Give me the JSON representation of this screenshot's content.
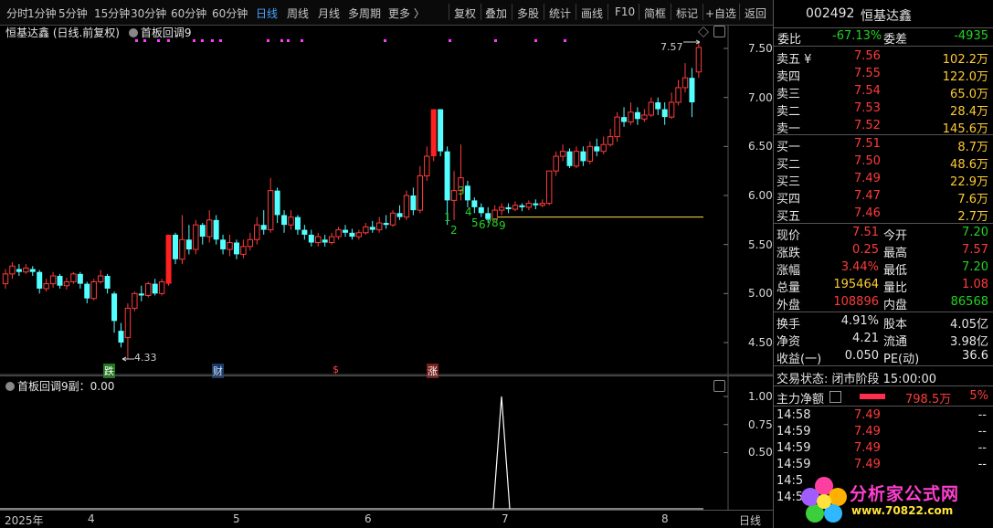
{
  "toolbar": {
    "items": [
      "分时",
      "1分钟",
      "5分钟",
      "15分钟",
      "30分钟",
      "60分钟",
      "日线",
      "周线",
      "月线",
      "多周期",
      "更多 〉"
    ],
    "right_items": [
      "复权",
      "叠加",
      "多股",
      "统计",
      "画线",
      "F10",
      "简框",
      "标记",
      "+自选",
      "返回"
    ]
  },
  "chart": {
    "title": "恒基达鑫 (日线.前复权)",
    "indicator": "首板回调9",
    "y_labels": [
      "7.50",
      "7.00",
      "6.50",
      "6.00",
      "5.50",
      "5.00",
      "4.50"
    ],
    "high_label": "7.57",
    "low_label": "4.33",
    "seq_labels": [
      "1",
      "2",
      "3",
      "4",
      "5",
      "6",
      "7",
      "8",
      "9"
    ],
    "flags": [
      "跌",
      "财",
      "$",
      "涨"
    ]
  },
  "sub_chart": {
    "title": "首板回调9副：0.00",
    "y_labels": [
      "1.00",
      "0.75",
      "0.50"
    ]
  },
  "xaxis": {
    "labels": [
      "2025年",
      "4",
      "5",
      "6",
      "7",
      "8"
    ],
    "period": "日线"
  },
  "quote": {
    "code": "002492",
    "name": "恒基达鑫",
    "weibi_label": "委比",
    "weibi": "-67.13%",
    "weicha_label": "委差",
    "weicha": "-4935",
    "asks": [
      {
        "label": "卖五 ¥",
        "price": "7.56",
        "vol": "102.2万"
      },
      {
        "label": "卖四",
        "price": "7.55",
        "vol": "122.0万"
      },
      {
        "label": "卖三",
        "price": "7.54",
        "vol": "65.0万"
      },
      {
        "label": "卖二",
        "price": "7.53",
        "vol": "28.4万"
      },
      {
        "label": "卖一",
        "price": "7.52",
        "vol": "145.6万"
      }
    ],
    "bids": [
      {
        "label": "买一",
        "price": "7.51",
        "vol": "8.7万"
      },
      {
        "label": "买二",
        "price": "7.50",
        "vol": "48.6万"
      },
      {
        "label": "买三",
        "price": "7.49",
        "vol": "22.9万"
      },
      {
        "label": "买四",
        "price": "7.47",
        "vol": "7.6万"
      },
      {
        "label": "买五",
        "price": "7.46",
        "vol": "2.7万"
      }
    ],
    "stats": [
      {
        "l1": "现价",
        "v1": "7.51",
        "c1": "red",
        "l2": "今开",
        "v2": "7.20",
        "c2": "green"
      },
      {
        "l1": "涨跌",
        "v1": "0.25",
        "c1": "red",
        "l2": "最高",
        "v2": "7.57",
        "c2": "red"
      },
      {
        "l1": "涨幅",
        "v1": "3.44%",
        "c1": "red",
        "l2": "最低",
        "v2": "7.20",
        "c2": "green"
      },
      {
        "l1": "总量",
        "v1": "195464",
        "c1": "yel",
        "l2": "量比",
        "v2": "1.08",
        "c2": "red"
      },
      {
        "l1": "外盘",
        "v1": "108896",
        "c1": "red",
        "l2": "内盘",
        "v2": "86568",
        "c2": "green"
      }
    ],
    "stats2": [
      {
        "l1": "换手",
        "v1": "4.91%",
        "l2": "股本",
        "v2": "4.05亿"
      },
      {
        "l1": "净资",
        "v1": "4.21",
        "l2": "流通",
        "v2": "3.98亿"
      },
      {
        "l1": "收益(一)",
        "v1": "0.050",
        "l2": "PE(动)",
        "v2": "36.6"
      }
    ],
    "status": "交易状态: 闭市阶段 15:00:00",
    "main_flow_label": "主力净额",
    "main_flow_value": "798.5万",
    "main_flow_pct": "5%",
    "ticks": [
      {
        "time": "14:58",
        "price": "7.49",
        "vol": "--"
      },
      {
        "time": "14:59",
        "price": "7.49",
        "vol": "--"
      },
      {
        "time": "14:59",
        "price": "7.49",
        "vol": "--"
      },
      {
        "time": "14:59",
        "price": "7.49",
        "vol": "--"
      },
      {
        "time": "14:5",
        "price": "",
        "vol": ""
      },
      {
        "time": "14:5",
        "price": "",
        "vol": ""
      }
    ]
  },
  "logo": {
    "text": "分析家公式网",
    "url": "www.70822.com"
  }
}
